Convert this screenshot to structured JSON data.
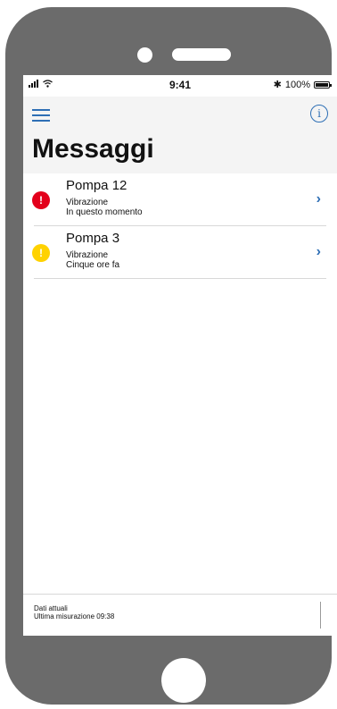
{
  "status_bar": {
    "time": "9:41",
    "battery": "100%"
  },
  "header": {
    "title": "Messaggi"
  },
  "messages": [
    {
      "title": "Pompa 12",
      "type": "Vibrazione",
      "time": "In questo momento",
      "severity_color": "#e3001b"
    },
    {
      "title": "Pompa 3",
      "type": "Vibrazione",
      "time": "Cinque ore fa",
      "severity_color": "#ffd200"
    }
  ],
  "footer": {
    "line1": "Dati attuali",
    "line2": "Ultima misurazione 09:38"
  },
  "colors": {
    "accent": "#2e6fb5",
    "phone_frame": "#6b6b6b"
  },
  "icons": {
    "menu": "hamburger-icon",
    "info": "info-icon",
    "chevron": "chevron-right-icon",
    "alert": "exclamation-icon"
  }
}
